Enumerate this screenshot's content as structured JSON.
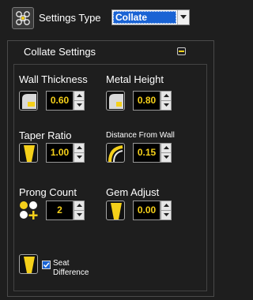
{
  "header": {
    "settings_type_label": "Settings Type",
    "settings_type_value": "Collate"
  },
  "panel": {
    "title": "Collate Settings",
    "fields": {
      "wall_thickness": {
        "label": "Wall Thickness",
        "value": "0.60"
      },
      "metal_height": {
        "label": "Metal Height",
        "value": "0.80"
      },
      "taper_ratio": {
        "label": "Taper Ratio",
        "value": "1.00"
      },
      "distance_from_wall": {
        "label": "Distance From Wall",
        "value": "0.15"
      },
      "prong_count": {
        "label": "Prong Count",
        "value": "2"
      },
      "gem_adjust": {
        "label": "Gem Adjust",
        "value": "0.00"
      }
    },
    "seat_difference": {
      "label_line1": "Seat",
      "label_line2": "Difference",
      "checked": true
    }
  },
  "colors": {
    "accent_yellow": "#f5d01a",
    "selection_blue": "#1a63d4",
    "background": "#1e1e1e"
  },
  "icons": {
    "settings_type": "collate-gems-icon",
    "wall_thickness": "wall-thickness-icon",
    "metal_height": "metal-height-icon",
    "taper_ratio": "taper-ratio-icon",
    "distance_from_wall": "distance-from-wall-icon",
    "prong_count": "prong-count-icon",
    "gem_adjust": "gem-adjust-icon",
    "seat_difference": "seat-difference-icon"
  }
}
